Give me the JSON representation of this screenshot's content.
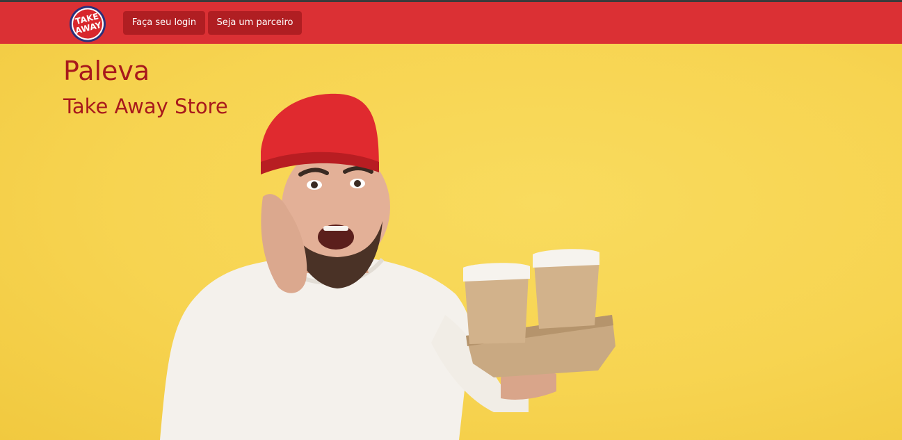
{
  "brand": {
    "logo_line1": "TAKE",
    "logo_line2": "AWAY"
  },
  "navbar": {
    "login_label": "Faça seu login",
    "partner_label": "Seja um parceiro"
  },
  "hero": {
    "title": "Paleva",
    "subtitle": "Take Away Store"
  },
  "colors": {
    "navbar_bg": "#db3034",
    "nav_button_bg": "#b01e22",
    "hero_bg": "#f7d451",
    "hero_text": "#a8191c"
  }
}
